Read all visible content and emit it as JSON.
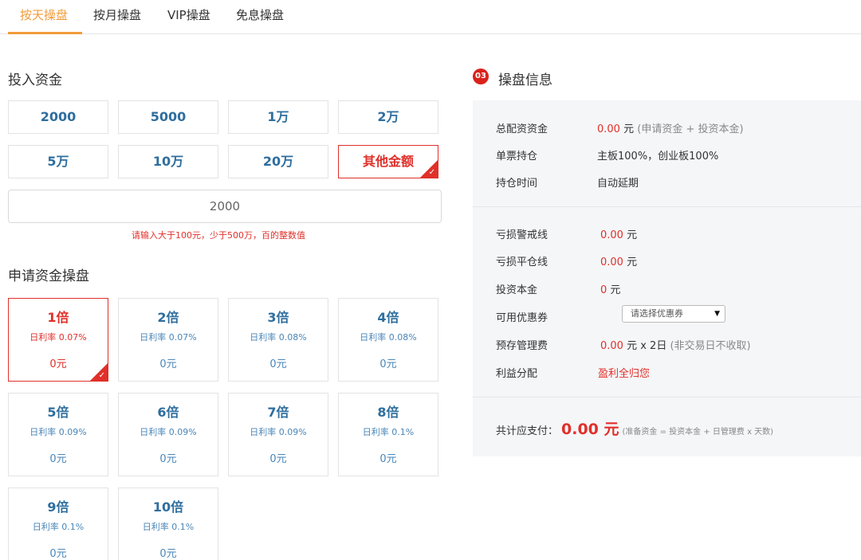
{
  "tabs": [
    "按天操盘",
    "按月操盘",
    "VIP操盘",
    "免息操盘"
  ],
  "invest": {
    "title": "投入资金",
    "amounts": [
      "2000",
      "5000",
      "1万",
      "2万",
      "5万",
      "10万",
      "20万",
      "其他金额"
    ],
    "input_value": "2000",
    "hint": "请输入大于100元，少于500万，百的整数值"
  },
  "leverage": {
    "title": "申请资金操盘",
    "options": [
      {
        "mult": "1倍",
        "rate": "日利率 0.07%",
        "cost": "0元"
      },
      {
        "mult": "2倍",
        "rate": "日利率 0.07%",
        "cost": "0元"
      },
      {
        "mult": "3倍",
        "rate": "日利率 0.08%",
        "cost": "0元"
      },
      {
        "mult": "4倍",
        "rate": "日利率 0.08%",
        "cost": "0元"
      },
      {
        "mult": "5倍",
        "rate": "日利率 0.09%",
        "cost": "0元"
      },
      {
        "mult": "6倍",
        "rate": "日利率 0.09%",
        "cost": "0元"
      },
      {
        "mult": "7倍",
        "rate": "日利率 0.09%",
        "cost": "0元"
      },
      {
        "mult": "8倍",
        "rate": "日利率 0.1%",
        "cost": "0元"
      },
      {
        "mult": "9倍",
        "rate": "日利率 0.1%",
        "cost": "0元"
      },
      {
        "mult": "10倍",
        "rate": "日利率 0.1%",
        "cost": "0元"
      }
    ]
  },
  "info": {
    "badge": "03",
    "title": "操盘信息",
    "total_funds": {
      "label": "总配资资金",
      "value": "0.00",
      "unit": "元",
      "note": "(申请资金 + 投资本金)"
    },
    "single_position": {
      "label": "单票持仓",
      "value": "主板100%，创业板100%"
    },
    "hold_time": {
      "label": "持仓时间",
      "value": "自动延期"
    },
    "warning_line": {
      "label": "亏损警戒线",
      "value": "0.00",
      "unit": "元"
    },
    "close_line": {
      "label": "亏损平仓线",
      "value": "0.00",
      "unit": "元"
    },
    "principal": {
      "label": "投资本金",
      "value": "0",
      "unit": "元"
    },
    "coupon": {
      "label": "可用优惠券",
      "placeholder": "请选择优惠券"
    },
    "mgmt_fee": {
      "label": "预存管理费",
      "value": "0.00",
      "unit": "元 x 2日",
      "note": "(非交易日不收取)"
    },
    "profit": {
      "label": "利益分配",
      "value": "盈利全归您"
    },
    "total": {
      "label": "共计应支付：",
      "value": "0.00 元",
      "note": "(准备资金 = 投资本金 + 日管理费 x 天数)"
    }
  },
  "colors": {
    "accent": "#f29b3a",
    "red": "#e0302a",
    "blue": "#2f6e9e",
    "panel": "#f5f6f8"
  }
}
